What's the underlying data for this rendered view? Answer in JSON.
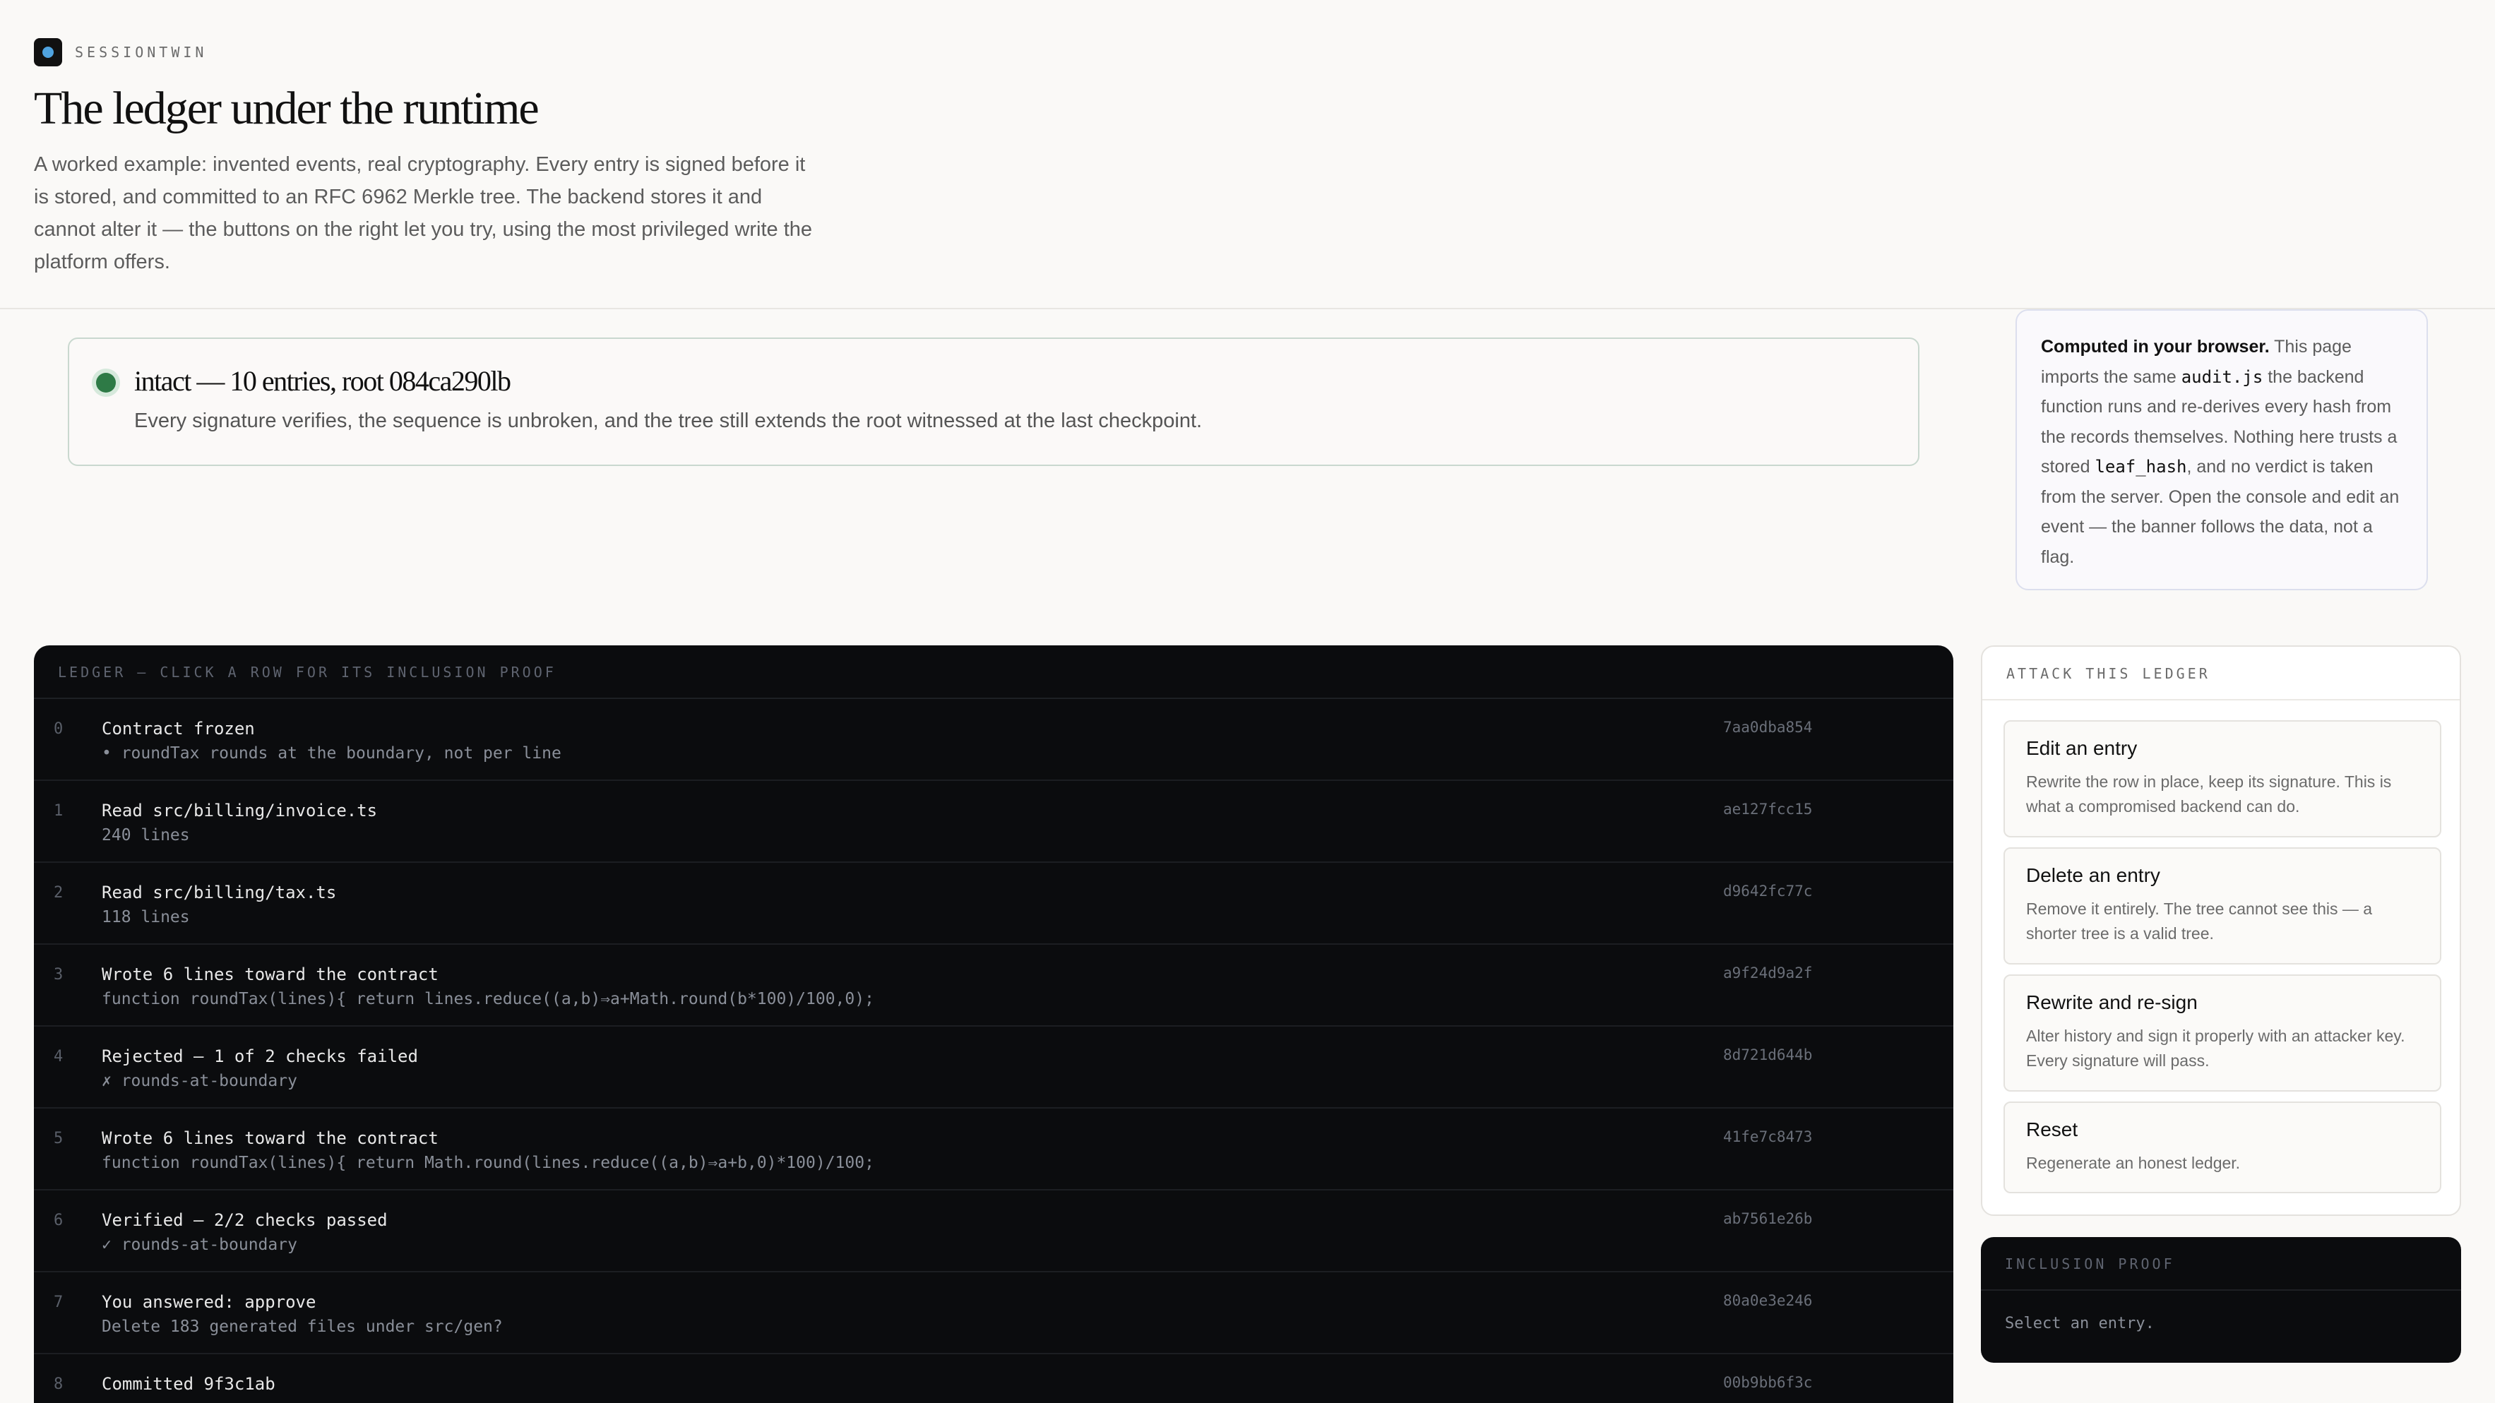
{
  "brand": {
    "name": "SESSIONTWIN",
    "logo_icon": "dot-logo-icon",
    "accent": "#4fa3e0"
  },
  "header": {
    "title": "The ledger under the runtime",
    "intro": "A worked example: invented events, real cryptography. Every entry is signed before it is stored, and committed to an RFC 6962 Merkle tree. The backend stores it and cannot alter it — the buttons on the right let you try, using the most privileged write the platform offers."
  },
  "status": {
    "title": "intact — 10 entries, root 084ca290lb",
    "description": "Every signature verifies, the sequence is unbroken, and the tree still extends the root witnessed at the last checkpoint.",
    "color": "#2e7a46"
  },
  "browser_note": {
    "lead": "Computed in your browser.",
    "t1": " This page imports the same ",
    "code1": "audit.js",
    "t2": " the backend function runs and re-derives every hash from the records themselves. Nothing here trusts a stored ",
    "code2": "leaf_hash",
    "t3": ", and no verdict is taken from the server. Open the console and edit an event — the banner follows the data, not a flag."
  },
  "ledger": {
    "header": "LEDGER — CLICK A ROW FOR ITS INCLUSION PROOF",
    "rows": [
      {
        "index": "0",
        "title": "Contract frozen",
        "detail": "• roundTax rounds at the boundary, not per line",
        "hash": "7aa0dba854"
      },
      {
        "index": "1",
        "title": "Read src/billing/invoice.ts",
        "detail": "240 lines",
        "hash": "ae127fcc15"
      },
      {
        "index": "2",
        "title": "Read src/billing/tax.ts",
        "detail": "118 lines",
        "hash": "d9642fc77c"
      },
      {
        "index": "3",
        "title": "Wrote 6 lines toward the contract",
        "detail": "function roundTax(lines){ return lines.reduce((a,b)⇒a+Math.round(b*100)/100,0);",
        "hash": "a9f24d9a2f"
      },
      {
        "index": "4",
        "title": "Rejected — 1 of 2 checks failed",
        "detail": "✗ rounds-at-boundary",
        "hash": "8d721d644b"
      },
      {
        "index": "5",
        "title": "Wrote 6 lines toward the contract",
        "detail": "function roundTax(lines){ return Math.round(lines.reduce((a,b)⇒a+b,0)*100)/100;",
        "hash": "41fe7c8473"
      },
      {
        "index": "6",
        "title": "Verified — 2/2 checks passed",
        "detail": "✓ rounds-at-boundary",
        "hash": "ab7561e26b"
      },
      {
        "index": "7",
        "title": "You answered: approve",
        "detail": "Delete 183 generated files under src/gen?",
        "hash": "80a0e3e246"
      },
      {
        "index": "8",
        "title": "Committed 9f3c1ab",
        "detail": "",
        "hash": "00b9bb6f3c"
      }
    ]
  },
  "attack": {
    "header": "ATTACK THIS LEDGER",
    "cards": [
      {
        "title": "Edit an entry",
        "desc": "Rewrite the row in place, keep its signature. This is what a compromised backend can do."
      },
      {
        "title": "Delete an entry",
        "desc": "Remove it entirely. The tree cannot see this — a shorter tree is a valid tree."
      },
      {
        "title": "Rewrite and re-sign",
        "desc": "Alter history and sign it properly with an attacker key. Every signature will pass."
      },
      {
        "title": "Reset",
        "desc": "Regenerate an honest ledger."
      }
    ]
  },
  "proof": {
    "header": "INCLUSION PROOF",
    "placeholder": "Select an entry."
  }
}
